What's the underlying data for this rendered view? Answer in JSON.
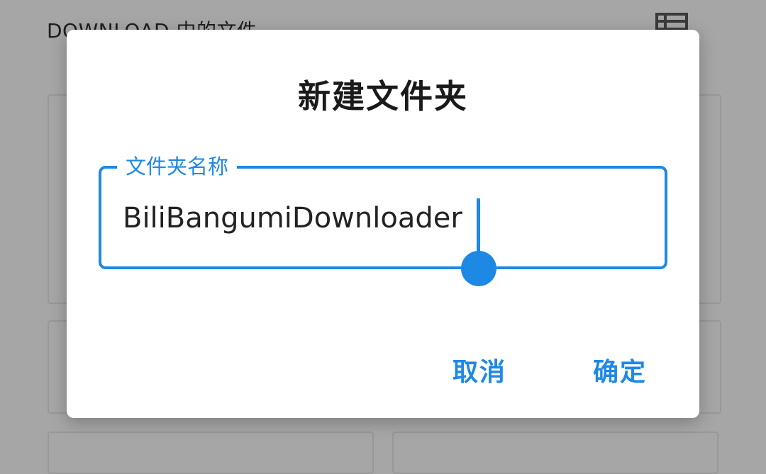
{
  "background": {
    "title": "DOWNLOAD 中的文件",
    "view_icon": "list-view-icon"
  },
  "dialog": {
    "title": "新建文件夹",
    "field": {
      "label": "文件夹名称",
      "value": "BiliBangumiDownloader"
    },
    "cancel_label": "取消",
    "confirm_label": "确定"
  },
  "colors": {
    "accent": "#1e88e5",
    "scrim": "#a6a6a6",
    "dialog_bg": "#ffffff",
    "text": "#222222"
  }
}
